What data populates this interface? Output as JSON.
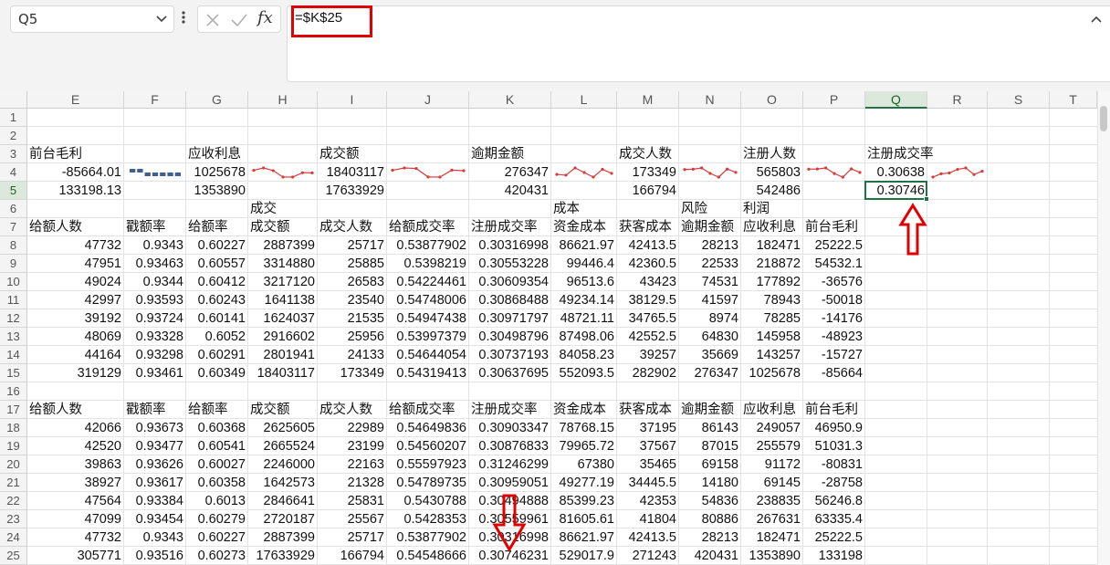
{
  "formula_bar": {
    "name_box": "Q5",
    "formula": "=$K$25",
    "fx_label": "fx"
  },
  "columns": [
    "E",
    "F",
    "G",
    "H",
    "I",
    "J",
    "K",
    "L",
    "M",
    "N",
    "O",
    "P",
    "Q",
    "R",
    "S",
    "T"
  ],
  "active_column": "Q",
  "rows": [
    "1",
    "2",
    "3",
    "4",
    "5",
    "6",
    "7",
    "8",
    "9",
    "10",
    "11",
    "12",
    "13",
    "14",
    "15",
    "16",
    "17",
    "18",
    "19",
    "20",
    "21",
    "22",
    "23",
    "24",
    "25"
  ],
  "active_row": "5",
  "summary": {
    "labels": {
      "E": "前台毛利",
      "G": "应收利息",
      "I": "成交额",
      "K": "逾期金额",
      "M": "成交人数",
      "O": "注册人数",
      "Q": "注册成交率"
    },
    "row4": {
      "E": "-85664.01",
      "G": "1025678",
      "I": "18403117",
      "K": "276347",
      "M": "173349",
      "O": "565803",
      "Q": "0.30638"
    },
    "row5": {
      "E": "133198.13",
      "G": "1353890",
      "I": "17633929",
      "K": "420431",
      "M": "166794",
      "O": "542486",
      "Q": "0.30746"
    }
  },
  "groups": {
    "H": "成交",
    "L": "成本",
    "N": "风险",
    "O": "利润"
  },
  "headers": [
    "给额人数",
    "戳额率",
    "给额率",
    "成交额",
    "成交人数",
    "给额成交率",
    "注册成交率",
    "资金成本",
    "获客成本",
    "逾期金额",
    "应收利息",
    "前台毛利"
  ],
  "table1": [
    [
      "47732",
      "0.9343",
      "0.60227",
      "2887399",
      "25717",
      "0.53877902",
      "0.30316998",
      "86621.97",
      "42413.5",
      "28213",
      "182471",
      "25222.5"
    ],
    [
      "47951",
      "0.93463",
      "0.60557",
      "3314880",
      "25885",
      "0.5398219",
      "0.30553228",
      "99446.4",
      "42360.5",
      "22533",
      "218872",
      "54532.1"
    ],
    [
      "49024",
      "0.9344",
      "0.60412",
      "3217120",
      "26583",
      "0.54224461",
      "0.30609354",
      "96513.6",
      "43423",
      "74531",
      "177892",
      "-36576"
    ],
    [
      "42997",
      "0.93593",
      "0.60243",
      "1641138",
      "23540",
      "0.54748006",
      "0.30868488",
      "49234.14",
      "38129.5",
      "41597",
      "78943",
      "-50018"
    ],
    [
      "39192",
      "0.93724",
      "0.60141",
      "1624037",
      "21535",
      "0.54947438",
      "0.30971797",
      "48721.11",
      "34765.5",
      "8974",
      "78285",
      "-14176"
    ],
    [
      "48069",
      "0.93328",
      "0.6052",
      "2916602",
      "25956",
      "0.53997379",
      "0.30498796",
      "87498.06",
      "42552.5",
      "64830",
      "145958",
      "-48923"
    ],
    [
      "44164",
      "0.93298",
      "0.60291",
      "2801941",
      "24133",
      "0.54644054",
      "0.30737193",
      "84058.23",
      "39257",
      "35669",
      "143257",
      "-15727"
    ],
    [
      "319129",
      "0.93461",
      "0.60349",
      "18403117",
      "173349",
      "0.54319413",
      "0.30637695",
      "552093.5",
      "282902",
      "276347",
      "1025678",
      "-85664"
    ]
  ],
  "table2": [
    [
      "42066",
      "0.93673",
      "0.60368",
      "2625605",
      "22989",
      "0.54649836",
      "0.30903347",
      "78768.15",
      "37195",
      "86143",
      "249057",
      "46950.9"
    ],
    [
      "42520",
      "0.93477",
      "0.60541",
      "2665524",
      "23199",
      "0.54560207",
      "0.30876833",
      "79965.72",
      "37567",
      "87015",
      "255579",
      "51031.3"
    ],
    [
      "39863",
      "0.93626",
      "0.60027",
      "2246000",
      "22163",
      "0.55597923",
      "0.31246299",
      "67380",
      "35465",
      "69158",
      "91172",
      "-80831"
    ],
    [
      "38927",
      "0.93617",
      "0.60358",
      "1642573",
      "21328",
      "0.54789735",
      "0.30959051",
      "49277.19",
      "34445.5",
      "14180",
      "69145",
      "-28758"
    ],
    [
      "47564",
      "0.93384",
      "0.6013",
      "2846641",
      "25831",
      "0.5430788",
      "0.30494888",
      "85399.23",
      "42353",
      "54836",
      "238835",
      "56246.8"
    ],
    [
      "47099",
      "0.93454",
      "0.60279",
      "2720187",
      "25567",
      "0.5428353",
      "0.30559961",
      "81605.61",
      "41804",
      "80886",
      "267631",
      "63335.4"
    ],
    [
      "47732",
      "0.9343",
      "0.60227",
      "2887399",
      "25717",
      "0.53877902",
      "0.30316998",
      "86621.97",
      "42413.5",
      "28213",
      "182471",
      "25222.5"
    ],
    [
      "305771",
      "0.93516",
      "0.60273",
      "17633929",
      "166794",
      "0.54548666",
      "0.30746231",
      "529017.9",
      "271243",
      "420431",
      "1353890",
      "133198"
    ]
  ],
  "colors": {
    "accent": "#217346",
    "annotation": "#e00000",
    "sparkline": "#d93a3a",
    "winloss": "#3f5f8f"
  }
}
